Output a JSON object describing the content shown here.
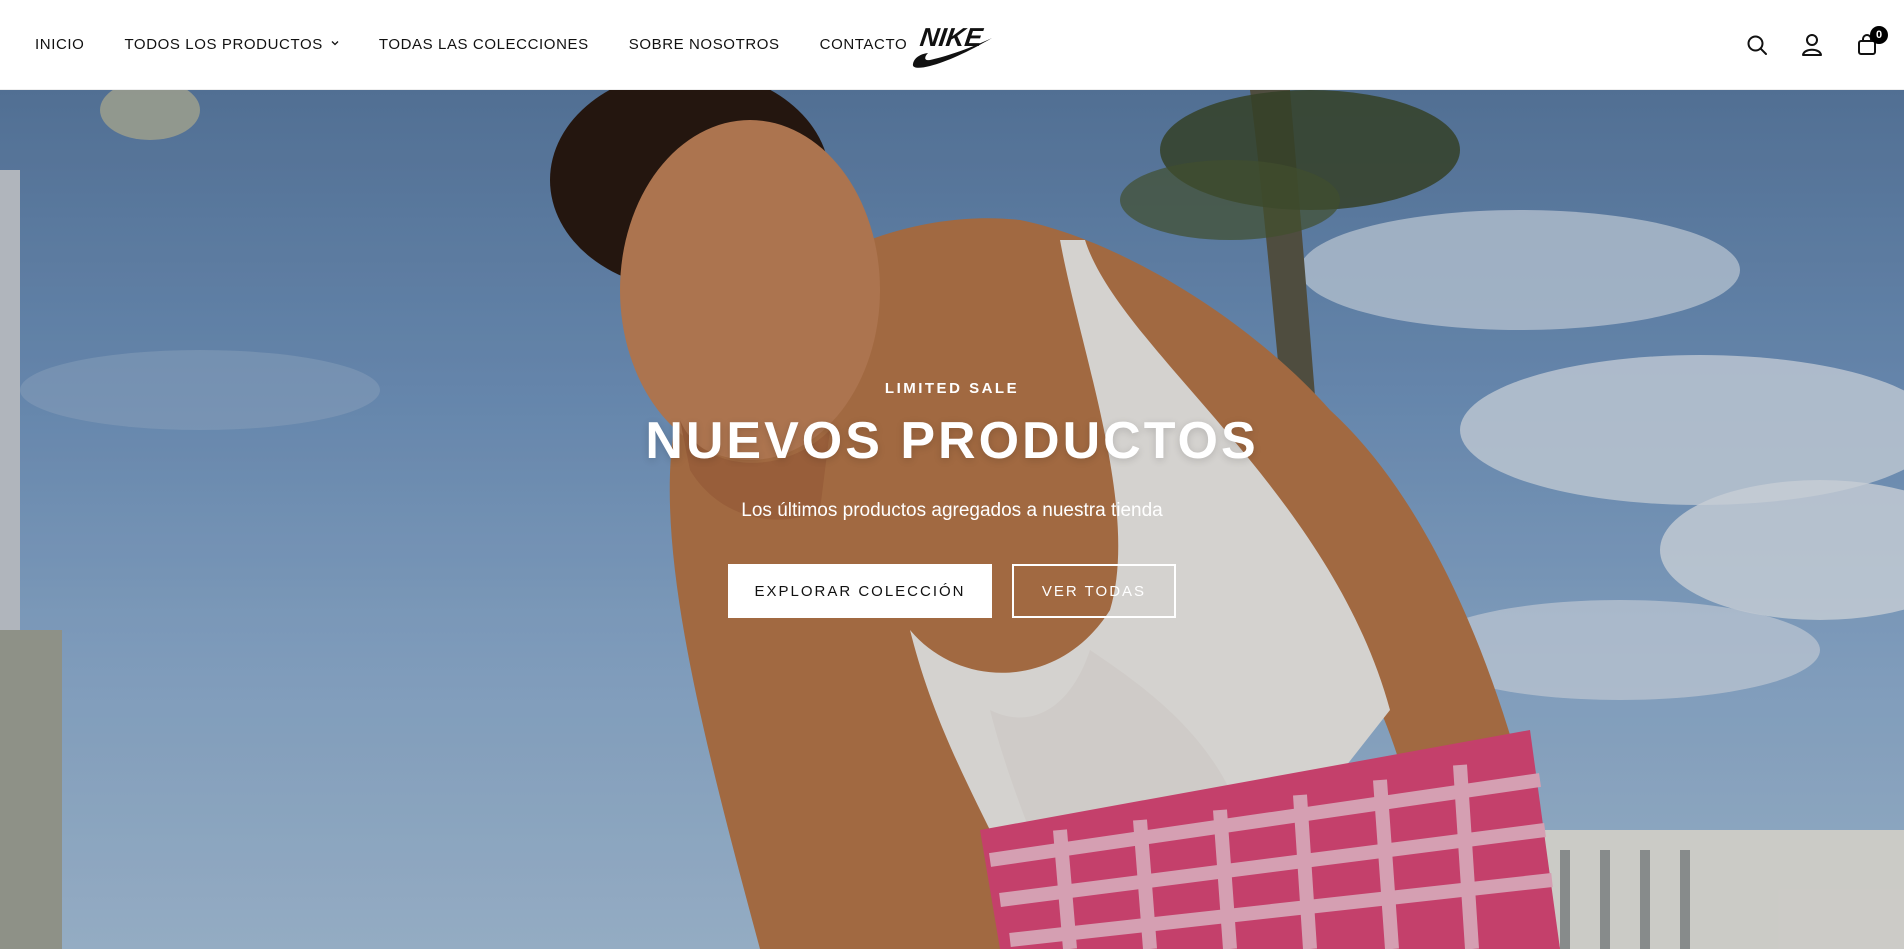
{
  "brand": {
    "logo_text": "NIKE"
  },
  "nav": {
    "items": [
      {
        "label": "INICIO",
        "has_dropdown": false
      },
      {
        "label": "TODOS LOS PRODUCTOS",
        "has_dropdown": true
      },
      {
        "label": "TODAS LAS COLECCIONES",
        "has_dropdown": false
      },
      {
        "label": "SOBRE NOSOTROS",
        "has_dropdown": false
      },
      {
        "label": "CONTACTO",
        "has_dropdown": false
      }
    ],
    "dropdown_icon": "chevron-down-icon"
  },
  "header_icons": {
    "search": "search-icon",
    "account": "user-icon",
    "cart": "shopping-bag-icon",
    "cart_count": "0"
  },
  "hero": {
    "eyebrow": "LIMITED SALE",
    "title": "NUEVOS PRODUCTOS",
    "subtitle": "Los últimos productos agregados a nuestra tienda",
    "primary_button": "EXPLORAR COLECCIÓN",
    "secondary_button": "VER TODAS"
  },
  "colors": {
    "header_bg": "#ffffff",
    "text": "#111111",
    "hero_text": "#ffffff",
    "sky": "#7398c3",
    "accent_pink": "#e0497a"
  }
}
